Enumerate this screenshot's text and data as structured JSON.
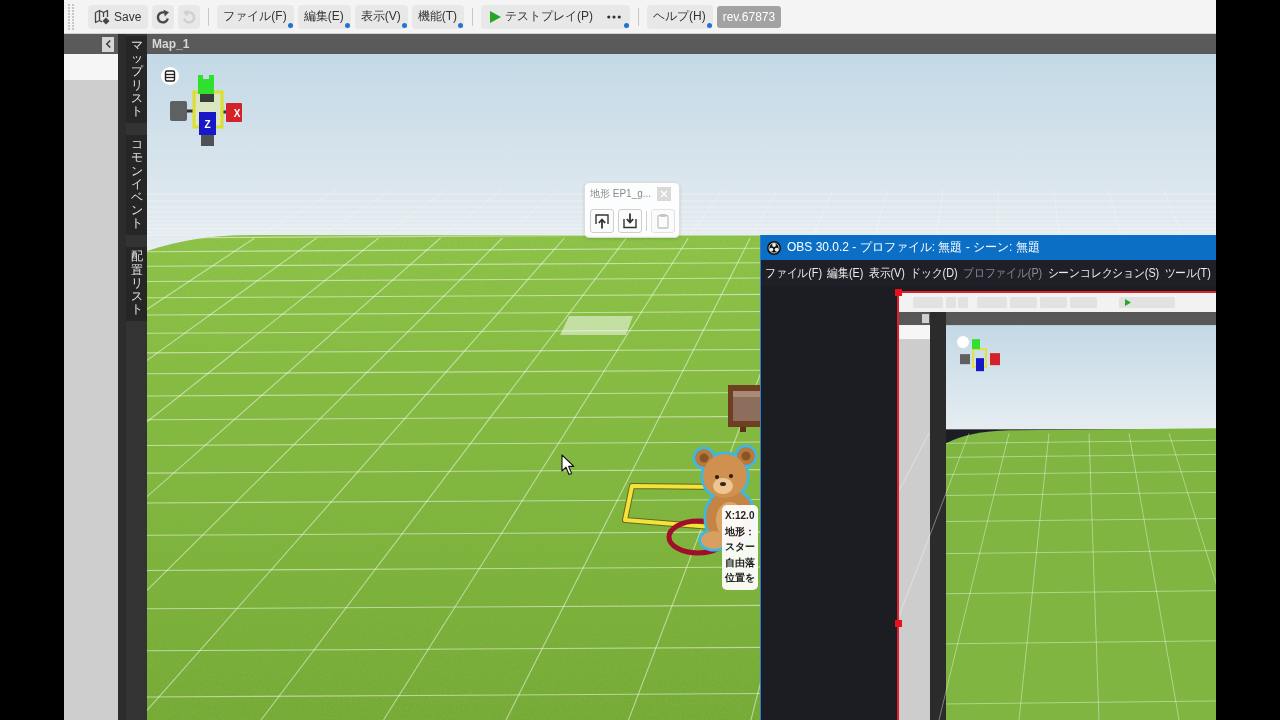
{
  "toolbar": {
    "save": {
      "label": "Save"
    },
    "undo": {
      "disabled": false
    },
    "redo": {
      "disabled": true
    },
    "menus": [
      {
        "label": "ファイル(F)"
      },
      {
        "label": "編集(E)"
      },
      {
        "label": "表示(V)"
      },
      {
        "label": "機能(T)"
      }
    ],
    "test_play": {
      "label": "テストプレイ(P)"
    },
    "help": {
      "label": "ヘルプ(H)"
    },
    "revision": "rev.67873"
  },
  "side_tabs": [
    {
      "label": "マップリスト",
      "selected": false
    },
    {
      "label": "コモンイベント",
      "selected": false
    },
    {
      "label": "配置リスト",
      "selected": false
    }
  ],
  "map_view": {
    "title": "Map_1",
    "gizmo": {
      "x_label": "X",
      "z_label": "Z"
    },
    "terrain_popup": {
      "title": "地形 EP1_g...",
      "buttons": [
        {
          "disabled": false
        },
        {
          "disabled": false
        },
        {
          "disabled": true
        }
      ]
    },
    "tooltip": {
      "lines": [
        "X:12.0",
        "地形：",
        "スター",
        "自由落",
        "位置を"
      ]
    }
  },
  "obs_window": {
    "title": "OBS 30.0.2 - プロファイル: 無題 - シーン: 無題",
    "menus": [
      {
        "label": "ファイル(F)",
        "disabled": false
      },
      {
        "label": "編集(E)",
        "disabled": false
      },
      {
        "label": "表示(V)",
        "disabled": false
      },
      {
        "label": "ドック(D)",
        "disabled": false
      },
      {
        "label": "プロファイル(P)",
        "disabled": true
      },
      {
        "label": "シーンコレクション(S)",
        "disabled": false
      },
      {
        "label": "ツール(T)",
        "disabled": false
      }
    ]
  }
}
